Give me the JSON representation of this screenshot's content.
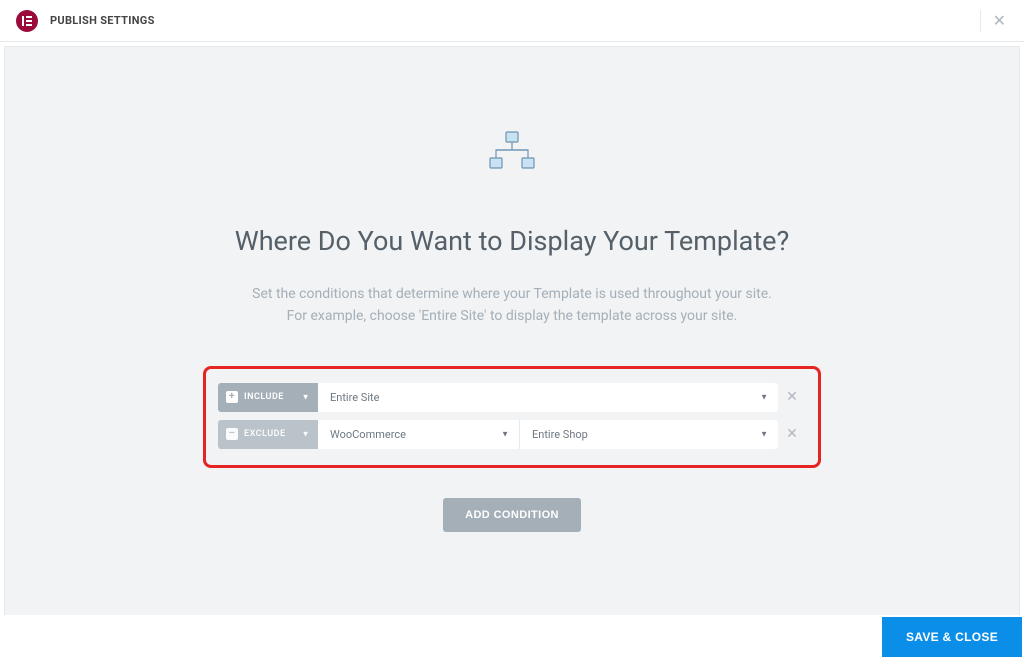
{
  "header": {
    "title": "PUBLISH SETTINGS"
  },
  "main": {
    "heading": "Where Do You Want to Display Your Template?",
    "subtitle_line1": "Set the conditions that determine where your Template is used throughout your site.",
    "subtitle_line2": "For example, choose 'Entire Site' to display the template across your site."
  },
  "conditions": [
    {
      "type_label": "INCLUDE",
      "toggle_symbol": "+",
      "selects": [
        {
          "value": "Entire Site"
        }
      ]
    },
    {
      "type_label": "EXCLUDE",
      "toggle_symbol": "–",
      "selects": [
        {
          "value": "WooCommerce"
        },
        {
          "value": "Entire Shop"
        }
      ]
    }
  ],
  "buttons": {
    "add_condition": "ADD CONDITION",
    "save_close": "SAVE & CLOSE"
  }
}
